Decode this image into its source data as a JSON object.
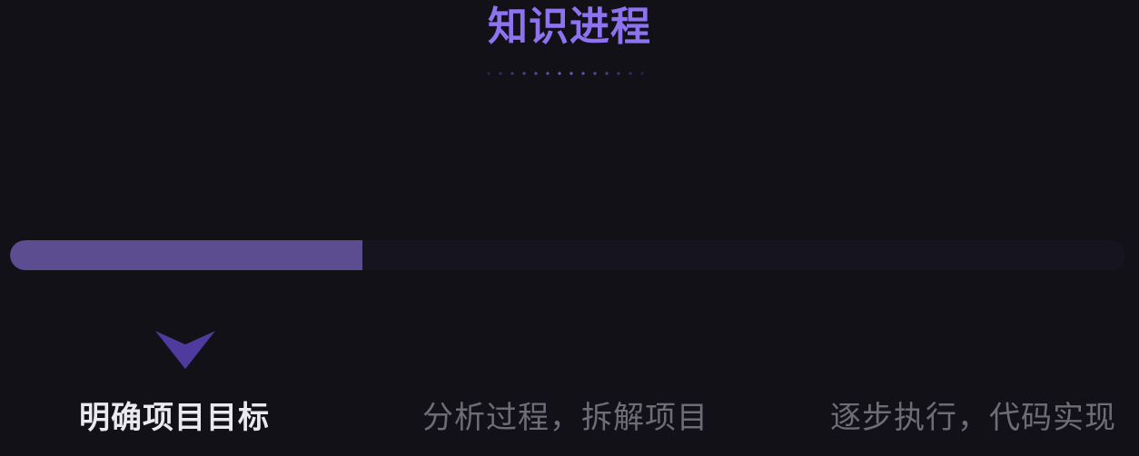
{
  "title": "知识进程",
  "progress": {
    "value": 0.316,
    "fill_color": "#5c4c90",
    "track_color": "#16141f"
  },
  "marker": {
    "icon": "chevron-down-icon",
    "color": "#4f3b9e"
  },
  "steps": [
    {
      "label": "明确项目目标",
      "state": "active"
    },
    {
      "label": "分析过程，拆解项目",
      "state": "inactive"
    },
    {
      "label": "逐步执行，代码实现",
      "state": "inactive"
    }
  ]
}
